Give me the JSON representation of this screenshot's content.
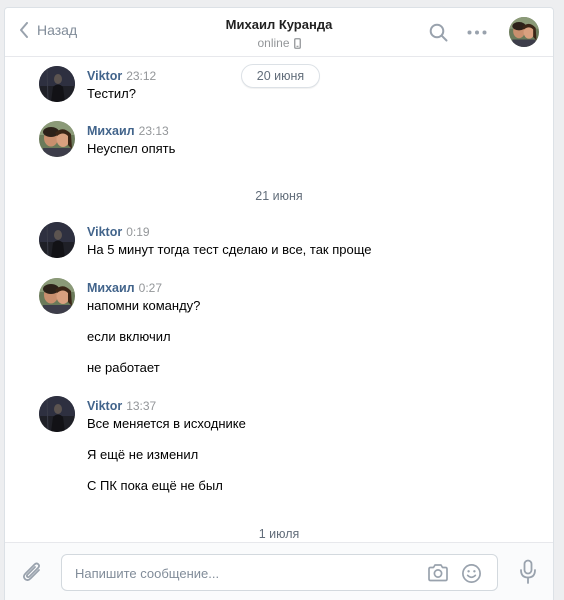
{
  "header": {
    "back_label": "Назад",
    "peer_name": "Михаил Куранда",
    "peer_status": "online"
  },
  "messages": [
    {
      "author": "Viktor",
      "time": "23:12",
      "lines": [
        "Тестил?"
      ],
      "avatar": "viktor"
    },
    {
      "author": "Михаил",
      "time": "23:13",
      "lines": [
        "Неуспел опять"
      ],
      "avatar": "mikhail"
    },
    {
      "author": "Viktor",
      "time": "0:19",
      "lines": [
        "На 5 минут тогда тест сделаю и все, так проще"
      ],
      "avatar": "viktor"
    },
    {
      "author": "Михаил",
      "time": "0:27",
      "lines": [
        "напомни команду?",
        "если включил",
        "не работает"
      ],
      "avatar": "mikhail"
    },
    {
      "author": "Viktor",
      "time": "13:37",
      "lines": [
        "Все меняется в исходнике",
        "Я ещё не изменил",
        "С ПК пока ещё не был"
      ],
      "avatar": "viktor"
    }
  ],
  "dates": {
    "floating": "20 июня",
    "sep1": "21 июня",
    "sep2": "1 июля"
  },
  "composer": {
    "placeholder": "Напишите сообщение..."
  },
  "colors": {
    "author": "#42648b",
    "muted": "#939699",
    "icon": "#99a2ad",
    "page_bg": "#edeef0"
  },
  "icons": [
    "chevron-left-icon",
    "search-icon",
    "more-icon",
    "mobile-phone-icon",
    "paperclip-icon",
    "camera-icon",
    "smile-icon",
    "microphone-icon"
  ]
}
